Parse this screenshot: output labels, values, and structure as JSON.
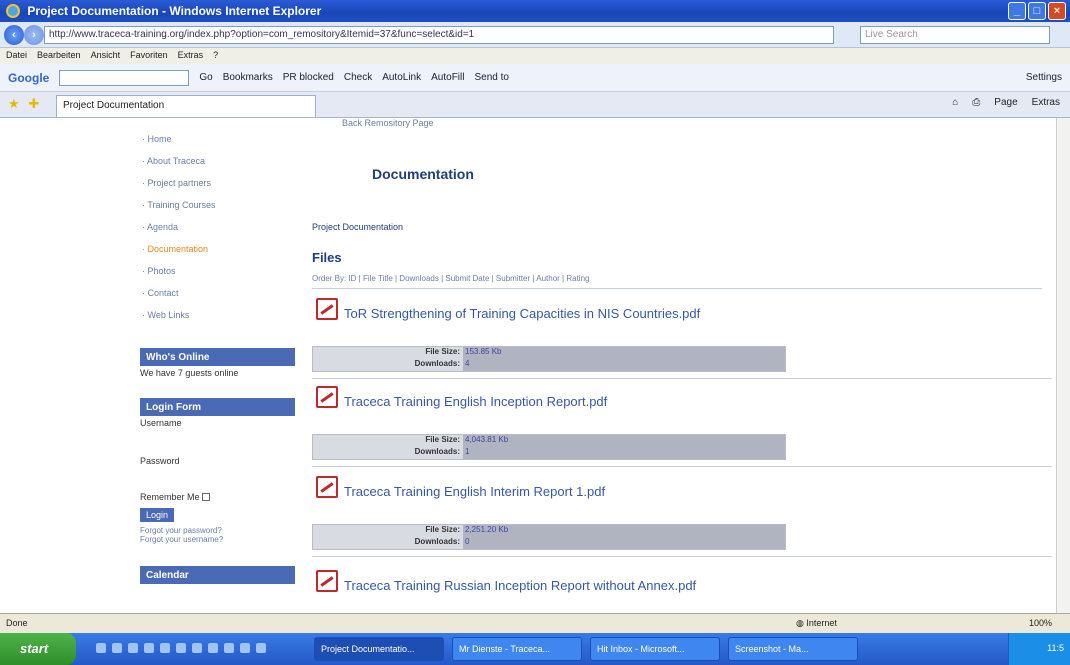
{
  "window": {
    "title": "Project Documentation - Windows Internet Explorer"
  },
  "address": {
    "url": "http://www.traceca-training.org/index.php?option=com_remository&Itemid=37&func=select&id=1",
    "search_placeholder": "Live Search"
  },
  "menubar": [
    "Datei",
    "Bearbeiten",
    "Ansicht",
    "Favoriten",
    "Extras",
    "?"
  ],
  "google": {
    "logo": "Google",
    "go": "Go",
    "bookmarks": "Bookmarks",
    "blocked": "PR blocked",
    "check": "Check",
    "autolink": "AutoLink",
    "autofill": "AutoFill",
    "send_to": "Send to",
    "settings": "Settings"
  },
  "tabbar": {
    "tab_title": "Project Documentation",
    "page": "Page",
    "extras": "Extras"
  },
  "sidebar": {
    "menu": [
      {
        "label": "Home",
        "active": false
      },
      {
        "label": "About Traceca",
        "active": false
      },
      {
        "label": "Project partners",
        "active": false
      },
      {
        "label": "Training Courses",
        "active": false
      },
      {
        "label": "Agenda",
        "active": false
      },
      {
        "label": "Documentation",
        "active": true
      },
      {
        "label": "Photos",
        "active": false
      },
      {
        "label": "Contact",
        "active": false
      },
      {
        "label": "Web Links",
        "active": false
      }
    ],
    "whos_online": {
      "title": "Who's Online",
      "text": "We have 7 guests online"
    },
    "login": {
      "title": "Login Form",
      "username": "Username",
      "password": "Password",
      "remember": "Remember Me",
      "button": "Login",
      "forgot_password": "Forgot your password?",
      "forgot_username": "Forgot your username?"
    },
    "calendar": {
      "title": "Calendar"
    }
  },
  "main": {
    "back_link": "Back Remository Page",
    "title": "Documentation",
    "section_link": "Project Documentation",
    "files_title": "Files",
    "orderby": "Order By: ID | File Title | Downloads | Submit Date | Submitter | Author | Rating",
    "files": [
      {
        "title": "ToR Strengthening of Training Capacities in NIS Countries.pdf",
        "size": "153.85 Kb",
        "downloads": "4"
      },
      {
        "title": "Traceca Training English Inception Report.pdf",
        "size": "4,043.81 Kb",
        "downloads": "1"
      },
      {
        "title": "Traceca Training English Interim Report 1.pdf",
        "size": "2,251.20 Kb",
        "downloads": "0"
      },
      {
        "title": "Traceca Training Russian Inception Report without Annex.pdf",
        "size": "",
        "downloads": ""
      }
    ],
    "labels": {
      "size": "File Size:",
      "downloads": "Downloads:"
    }
  },
  "statusbar": {
    "left": "Done",
    "zone": "Internet",
    "zoom": "100%"
  },
  "taskbar": {
    "start": "start",
    "tasks": [
      "Project Documentatio...",
      "Mr Dienste - Traceca...",
      "Hit Inbox - Microsoft...",
      "Screenshot - Ma..."
    ],
    "clock": "11:5"
  }
}
